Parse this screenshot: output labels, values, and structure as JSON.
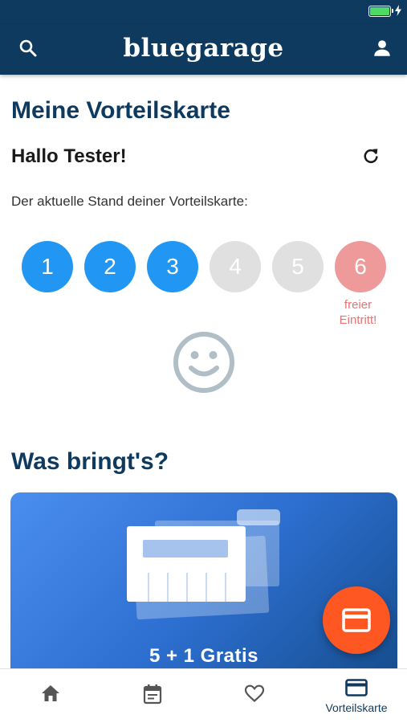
{
  "app": {
    "brand": "bluegarage"
  },
  "page": {
    "title": "Meine Vorteilskarte",
    "greeting": "Hallo Tester!",
    "card_status_text": "Der aktuelle Stand deiner Vorteilskarte:"
  },
  "stamps": {
    "items": [
      {
        "label": "1",
        "state": "filled"
      },
      {
        "label": "2",
        "state": "filled"
      },
      {
        "label": "3",
        "state": "filled"
      },
      {
        "label": "4",
        "state": "empty"
      },
      {
        "label": "5",
        "state": "empty"
      },
      {
        "label": "6",
        "state": "bonus"
      }
    ],
    "filled_count": 3,
    "bonus_label_line1": "freier",
    "bonus_label_line2": "Eintritt!"
  },
  "benefits": {
    "heading": "Was bringt's?",
    "promo_title": "5 + 1 Gratis"
  },
  "bottom_nav": {
    "items": [
      {
        "icon": "home-icon",
        "label": ""
      },
      {
        "icon": "calendar-icon",
        "label": ""
      },
      {
        "icon": "heart-icon",
        "label": ""
      },
      {
        "icon": "card-icon",
        "label": "Vorteilskarte"
      }
    ],
    "active_index": 3
  },
  "colors": {
    "primary": "#0e3a5f",
    "stamp_filled": "#2196f3",
    "stamp_empty": "#e0e0e0",
    "stamp_bonus": "#ef9a9a",
    "bonus_text": "#e57373",
    "fab": "#ff5722"
  },
  "icons": {
    "search": "search-icon",
    "account": "account-icon",
    "refresh": "refresh-icon",
    "smiley": "smiley-icon",
    "fab": "card-icon",
    "battery": "battery-icon"
  }
}
